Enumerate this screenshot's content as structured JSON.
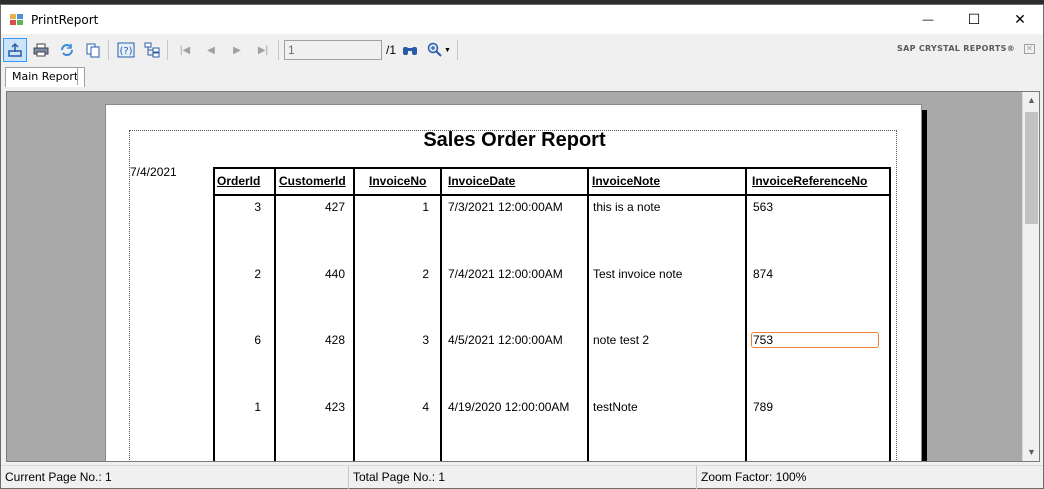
{
  "window": {
    "title": "PrintReport",
    "minimize_glyph": "—",
    "maximize_glyph": "☐",
    "close_glyph": "✕"
  },
  "toolbar": {
    "page_input_value": "1",
    "page_total": "/1",
    "brand": "SAP CRYSTAL REPORTS®",
    "icons": [
      "export-icon",
      "print-icon",
      "refresh-icon",
      "copy-icon",
      "help-icon",
      "group-tree-icon",
      "first-page-icon",
      "prev-page-icon",
      "next-page-icon",
      "last-page-icon",
      "find-icon",
      "zoom-icon"
    ]
  },
  "tabs": {
    "main": "Main Report"
  },
  "report": {
    "title": "Sales Order Report",
    "date": "7/4/2021",
    "columns": [
      "OrderId",
      "CustomerId",
      "InvoiceNo",
      "InvoiceDate",
      "InvoiceNote",
      "InvoiceReferenceNo"
    ],
    "rows": [
      {
        "order_id": "3",
        "customer_id": "427",
        "invoice_no": "1",
        "invoice_date": "7/3/2021  12:00:00AM",
        "invoice_note": "this is a note",
        "invoice_ref": "563"
      },
      {
        "order_id": "2",
        "customer_id": "440",
        "invoice_no": "2",
        "invoice_date": "7/4/2021  12:00:00AM",
        "invoice_note": "Test invoice note",
        "invoice_ref": "874"
      },
      {
        "order_id": "6",
        "customer_id": "428",
        "invoice_no": "3",
        "invoice_date": "4/5/2021  12:00:00AM",
        "invoice_note": "note test 2",
        "invoice_ref": "753"
      },
      {
        "order_id": "1",
        "customer_id": "423",
        "invoice_no": "4",
        "invoice_date": "4/19/2020  12:00:00AM",
        "invoice_note": "testNote",
        "invoice_ref": "789"
      }
    ]
  },
  "status": {
    "current_page": "Current Page No.: 1",
    "total_page": "Total Page No.: 1",
    "zoom": "Zoom Factor: 100%"
  },
  "colors": {
    "accent": "#3399ff",
    "highlight": "#e8823a"
  }
}
